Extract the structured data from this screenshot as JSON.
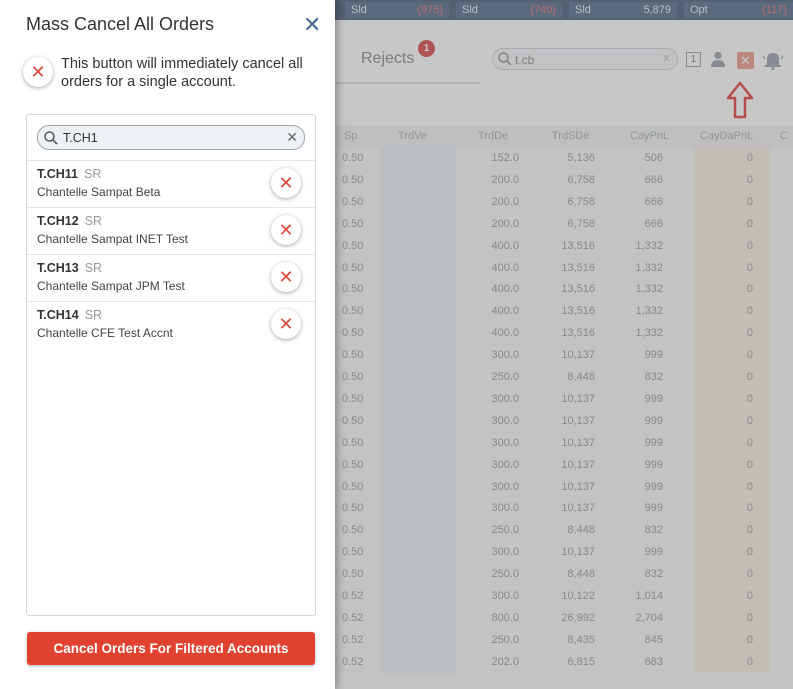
{
  "topbar": {
    "cells": [
      {
        "label": "Sld",
        "value": "(975)",
        "negative": true
      },
      {
        "label": "Sld",
        "value": "(740)",
        "negative": true
      },
      {
        "label": "Sld",
        "value": "5,879",
        "negative": false
      },
      {
        "label": "Opt",
        "value": "(117)",
        "negative": true
      }
    ]
  },
  "toolbar": {
    "rejects_tab": "Rejects",
    "rejects_badge": "1",
    "account_search_value": "t.cb",
    "box_number": "1"
  },
  "grid": {
    "columns": [
      "Sp",
      "TrdVe",
      "TrdDe",
      "TrdSDe",
      "CayPnL",
      "CayDaPnL",
      "C"
    ],
    "rows": [
      [
        "0.50",
        "152.0",
        "5,136",
        "506",
        "0"
      ],
      [
        "0.50",
        "200.0",
        "6,758",
        "666",
        "0"
      ],
      [
        "0.50",
        "200.0",
        "6,758",
        "666",
        "0"
      ],
      [
        "0.50",
        "200.0",
        "6,758",
        "666",
        "0"
      ],
      [
        "0.50",
        "400.0",
        "13,516",
        "1,332",
        "0"
      ],
      [
        "0.50",
        "400.0",
        "13,516",
        "1,332",
        "0"
      ],
      [
        "0.50",
        "400.0",
        "13,516",
        "1,332",
        "0"
      ],
      [
        "0.50",
        "400.0",
        "13,516",
        "1,332",
        "0"
      ],
      [
        "0.50",
        "400.0",
        "13,516",
        "1,332",
        "0"
      ],
      [
        "0.50",
        "300.0",
        "10,137",
        "999",
        "0"
      ],
      [
        "0.50",
        "250.0",
        "8,448",
        "832",
        "0"
      ],
      [
        "0.50",
        "300.0",
        "10,137",
        "999",
        "0"
      ],
      [
        "0.50",
        "300.0",
        "10,137",
        "999",
        "0"
      ],
      [
        "0.50",
        "300.0",
        "10,137",
        "999",
        "0"
      ],
      [
        "0.50",
        "300.0",
        "10,137",
        "999",
        "0"
      ],
      [
        "0.50",
        "300.0",
        "10,137",
        "999",
        "0"
      ],
      [
        "0.50",
        "300.0",
        "10,137",
        "999",
        "0"
      ],
      [
        "0.50",
        "250.0",
        "8,448",
        "832",
        "0"
      ],
      [
        "0.50",
        "300.0",
        "10,137",
        "999",
        "0"
      ],
      [
        "0.50",
        "250.0",
        "8,448",
        "832",
        "0"
      ],
      [
        "0.52",
        "300.0",
        "10,122",
        "1,014",
        "0"
      ],
      [
        "0.52",
        "800.0",
        "26,992",
        "2,704",
        "0"
      ],
      [
        "0.52",
        "250.0",
        "8,435",
        "845",
        "0"
      ],
      [
        "0.52",
        "202.0",
        "6,815",
        "683",
        "0"
      ]
    ]
  },
  "modal": {
    "title": "Mass Cancel All Orders",
    "close_glyph": "✕",
    "hint_text": "This button will immediately cancel all orders for a single account.",
    "filter_value": "T.CH1",
    "accounts": [
      {
        "code": "T.CH11",
        "type": "SR",
        "name": "Chantelle Sampat Beta"
      },
      {
        "code": "T.CH12",
        "type": "SR",
        "name": "Chantelle Sampat INET Test"
      },
      {
        "code": "T.CH13",
        "type": "SR",
        "name": "Chantelle Sampat JPM Test"
      },
      {
        "code": "T.CH14",
        "type": "SR",
        "name": "Chantelle CFE Test Accnt"
      }
    ],
    "cancel_filtered_label": "Cancel Orders For Filtered Accounts"
  },
  "icons": {
    "search": "search-icon",
    "close": "close-icon",
    "person": "person-icon",
    "bell": "bell-icon",
    "cancel": "cancel-x-icon",
    "arrow": "up-arrow-annotation-icon"
  },
  "colors": {
    "accent_red": "#e0422f",
    "header_blue": "#2e4566",
    "close_blue": "#4a6c92"
  }
}
